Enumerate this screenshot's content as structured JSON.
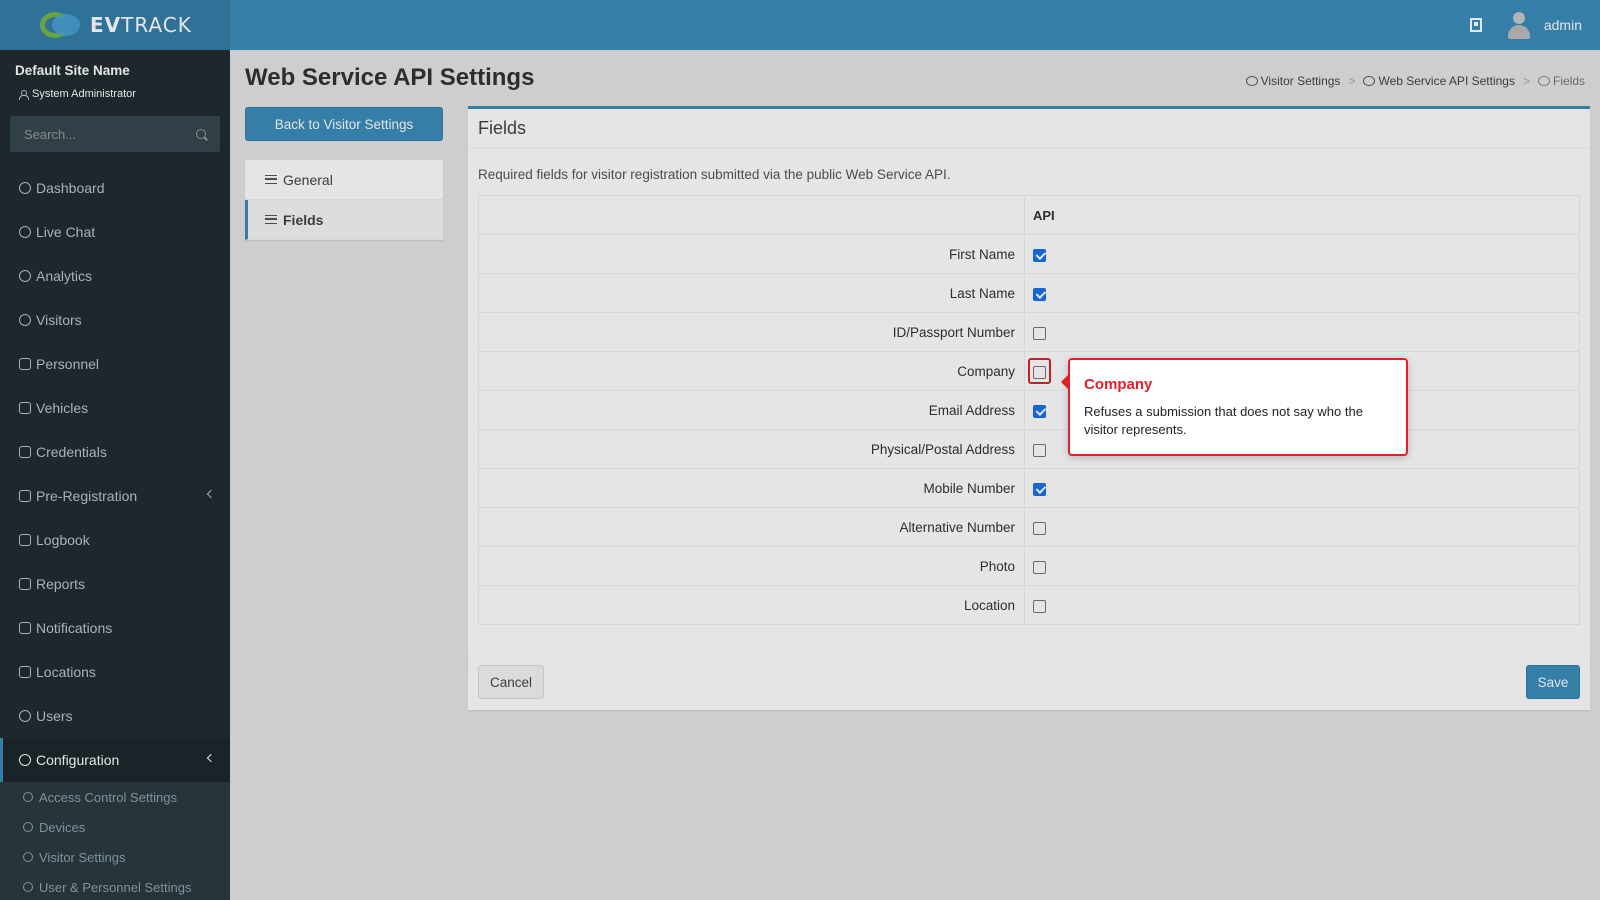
{
  "app": {
    "brand_bold": "EV",
    "brand_rest": "TRACK",
    "username": "admin"
  },
  "sidebar": {
    "site_name": "Default Site Name",
    "role": "System Administrator",
    "search_placeholder": "Search...",
    "items": [
      {
        "label": "Dashboard",
        "icon": "dashboard-icon"
      },
      {
        "label": "Live Chat",
        "icon": "headset-icon"
      },
      {
        "label": "Analytics",
        "icon": "target-icon"
      },
      {
        "label": "Visitors",
        "icon": "eye-icon"
      },
      {
        "label": "Personnel",
        "icon": "people-icon"
      },
      {
        "label": "Vehicles",
        "icon": "car-icon"
      },
      {
        "label": "Credentials",
        "icon": "badge-icon"
      },
      {
        "label": "Pre-Registration",
        "icon": "arrows-icon"
      },
      {
        "label": "Logbook",
        "icon": "book-icon"
      },
      {
        "label": "Reports",
        "icon": "chart-icon"
      },
      {
        "label": "Notifications",
        "icon": "chat-icon"
      },
      {
        "label": "Locations",
        "icon": "map-icon"
      },
      {
        "label": "Users",
        "icon": "user-icon"
      },
      {
        "label": "Configuration",
        "icon": "gear-icon"
      }
    ],
    "sub_items": [
      {
        "label": "Access Control Settings",
        "icon": "lock-icon"
      },
      {
        "label": "Devices",
        "icon": "devices-icon"
      },
      {
        "label": "Visitor Settings",
        "icon": "eye-icon"
      },
      {
        "label": "User & Personnel Settings",
        "icon": "user-settings-icon"
      }
    ]
  },
  "page": {
    "title": "Web Service API Settings",
    "breadcrumb": [
      "Visitor Settings",
      ">",
      "Web Service API Settings",
      ">",
      "Fields"
    ],
    "back_button": "Back to Visitor Settings",
    "nav": [
      "General",
      "Fields"
    ]
  },
  "panel": {
    "title": "Fields",
    "description": "Required fields for visitor registration submitted via the public Web Service API.",
    "column_header": "API",
    "rows": [
      {
        "label": "First Name",
        "checked": true
      },
      {
        "label": "Last Name",
        "checked": true
      },
      {
        "label": "ID/Passport Number",
        "checked": false
      },
      {
        "label": "Company",
        "checked": false
      },
      {
        "label": "Email Address",
        "checked": true
      },
      {
        "label": "Physical/Postal Address",
        "checked": false
      },
      {
        "label": "Mobile Number",
        "checked": true
      },
      {
        "label": "Alternative Number",
        "checked": false
      },
      {
        "label": "Photo",
        "checked": false
      },
      {
        "label": "Location",
        "checked": false
      }
    ]
  },
  "footer": {
    "cancel_label": "Cancel",
    "save_label": "Save"
  },
  "tooltip": {
    "title": "Company",
    "body": "Refuses a submission that does not say who the visitor represents."
  },
  "colors": {
    "header": "#3c8dbc",
    "sidebar": "#222d32",
    "highlight": "#e0202a"
  }
}
